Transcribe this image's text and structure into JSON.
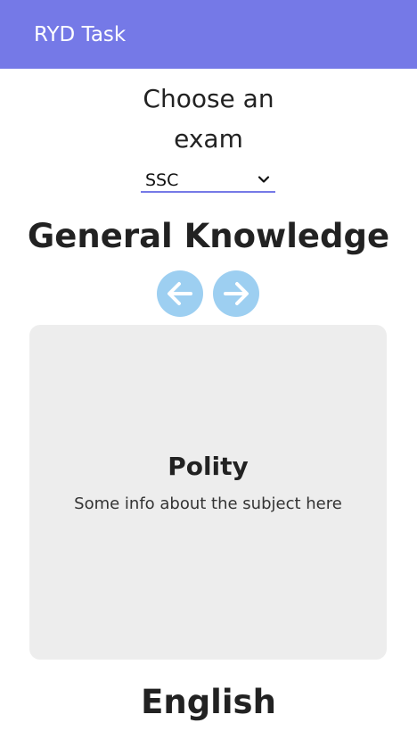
{
  "app_bar": {
    "title": "RYD Task",
    "color": "#7579e7"
  },
  "exam_picker": {
    "prompt_line1": "Choose an",
    "prompt_line2": "exam",
    "selected": "SSC"
  },
  "sections": [
    {
      "title": "General Knowledge",
      "card": {
        "title": "Polity",
        "info": "Some info about the subject here"
      }
    },
    {
      "title": "English"
    }
  ],
  "icons": {
    "prev": "arrow-left-icon",
    "next": "arrow-right-icon",
    "select": "chevron-down-icon"
  },
  "colors": {
    "accent": "#7579e7",
    "nav_button": "#9dcff1",
    "card_background": "#ededed"
  }
}
